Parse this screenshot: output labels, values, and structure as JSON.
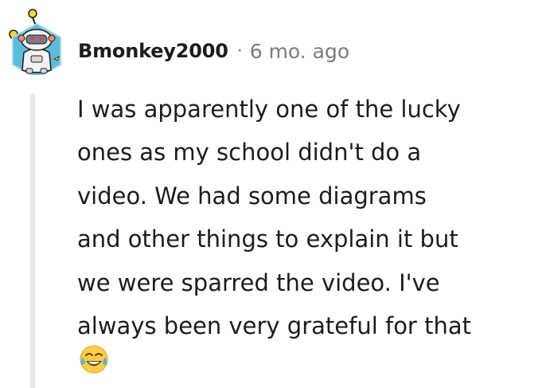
{
  "comment": {
    "username": "Bmonkey2000",
    "separator": "·",
    "timestamp": "6 mo. ago",
    "body_lines": [
      "I was apparently one of the lucky",
      "ones as my school didn't do a",
      "video. We had some diagrams",
      "and other things to explain it but",
      "we were sparred the video. I've",
      "always been very grateful for that"
    ],
    "emoji": "face-with-tears-of-joy-icon"
  },
  "colors": {
    "text": "#1c1c1c",
    "meta_text": "#7c7c7c",
    "thread_line": "#e9e9e9",
    "avatar_bg": "#5fbcd8",
    "avatar_accent": "#ff4500",
    "emoji_face": "#ffcc4d",
    "emoji_tears": "#5dadec"
  }
}
